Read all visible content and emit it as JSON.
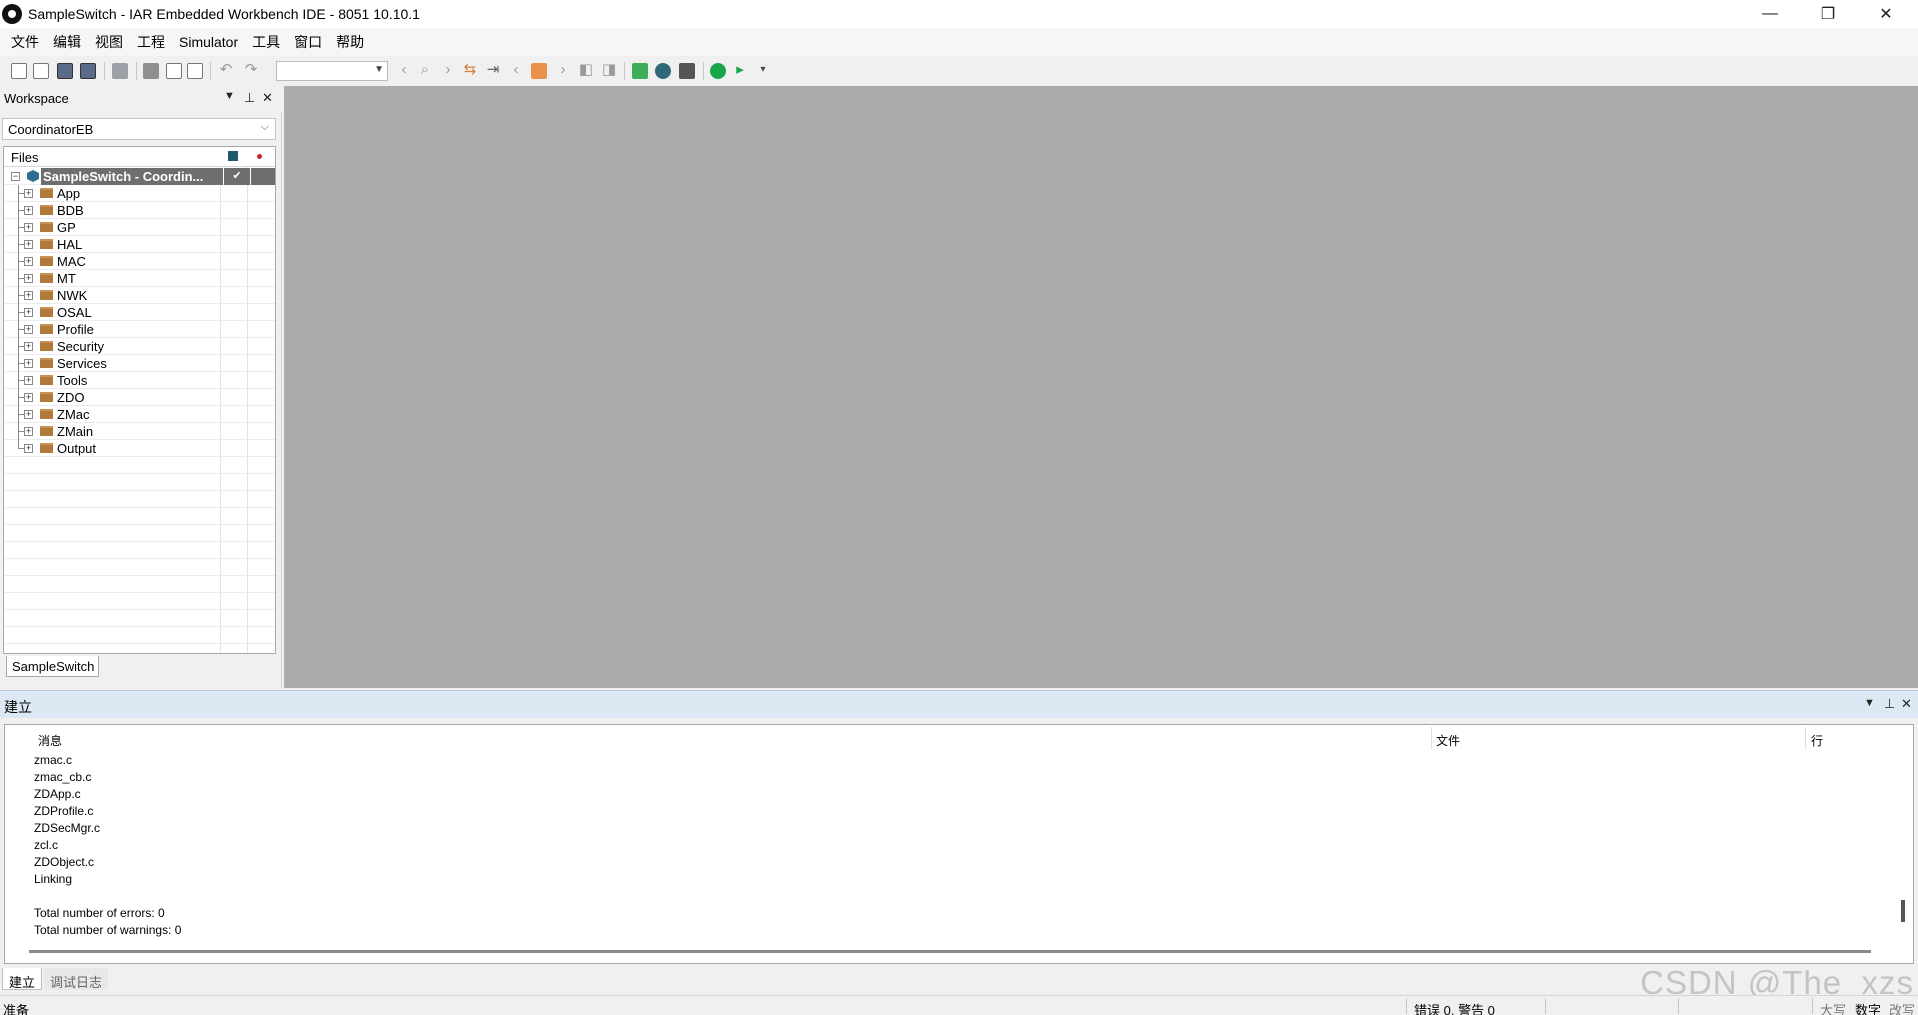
{
  "window": {
    "title": "SampleSwitch - IAR Embedded Workbench IDE - 8051 10.10.1",
    "minimize_symbol": "—",
    "restore_symbol": "❐",
    "close_symbol": "✕"
  },
  "menu": [
    "文件",
    "编辑",
    "视图",
    "工程",
    "Simulator",
    "工具",
    "窗口",
    "帮助"
  ],
  "toolbar": {
    "combo_value": "",
    "icons": [
      "new-file-icon",
      "open-file-icon",
      "save-icon",
      "save-all-icon",
      "print-icon",
      "cut-icon",
      "copy-icon",
      "paste-icon",
      "undo-icon",
      "redo-icon",
      "find-back-icon",
      "find-icon",
      "find-next-icon",
      "replace-icon",
      "goto-icon",
      "nav-back-icon",
      "bookmark-icon",
      "nav-forward-icon",
      "prev-bookmark-icon",
      "next-bookmark-icon",
      "compile-icon",
      "make-icon",
      "breakpoint-icon",
      "debug-download-icon",
      "debug-no-download-icon"
    ]
  },
  "workspace": {
    "title": "Workspace",
    "configuration": "CoordinatorEB",
    "files_header": "Files",
    "project": {
      "name": "SampleSwitch - Coordin...",
      "check_mark": "✔"
    },
    "groups": [
      "App",
      "BDB",
      "GP",
      "HAL",
      "MAC",
      "MT",
      "NWK",
      "OSAL",
      "Profile",
      "Security",
      "Services",
      "Tools",
      "ZDO",
      "ZMac",
      "ZMain",
      "Output"
    ],
    "tab": "SampleSwitch"
  },
  "build": {
    "title": "建立",
    "columns": {
      "message": "消息",
      "file": "文件",
      "line": "行"
    },
    "messages": [
      "zmac.c",
      "zmac_cb.c",
      "ZDApp.c",
      "ZDProfile.c",
      "ZDSecMgr.c",
      "zcl.c",
      "ZDObject.c",
      "Linking",
      "",
      "Total number of errors: 0",
      "Total number of warnings: 0"
    ],
    "tabs": [
      "建立",
      "调试日志"
    ]
  },
  "status": {
    "left": "准备",
    "errors": "错误 0, 警告 0",
    "caps": "大写",
    "num": "数字",
    "ovr": "改写"
  },
  "watermark": "CSDN @The_xzs"
}
